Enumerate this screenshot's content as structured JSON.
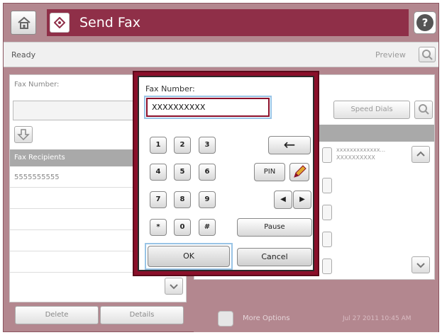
{
  "header": {
    "title": "Send Fax",
    "home_icon": "home-icon",
    "fax_icon": "fax-icon",
    "help_icon": "help-icon",
    "help_glyph": "?"
  },
  "status": {
    "text": "Ready",
    "preview_label": "Preview",
    "preview_icon": "magnifier-icon"
  },
  "left_panel": {
    "fax_number_label": "Fax Number:",
    "recipients_header": "Fax Recipients",
    "recipients": [
      "5555555555"
    ],
    "delete_label": "Delete",
    "details_label": "Details"
  },
  "right_panel": {
    "speed_dials_label": "Speed Dials",
    "entry_line1": "xxxxxxxxxxxxx...",
    "entry_line2": "XXXXXXXXXX",
    "more_options_label": "More Options",
    "datetime": "Jul 27 2011 10:45 AM"
  },
  "dialog": {
    "label": "Fax Number:",
    "input_value": "XXXXXXXXXX",
    "keys": [
      "1",
      "2",
      "3",
      "4",
      "5",
      "6",
      "7",
      "8",
      "9",
      "*",
      "0",
      "#"
    ],
    "backspace_glyph": "←",
    "pin_label": "PIN",
    "left_glyph": "◀",
    "right_glyph": "▶",
    "pause_label": "Pause",
    "ok_label": "OK",
    "cancel_label": "Cancel"
  },
  "colors": {
    "title_bar": "#8f2f48",
    "frame": "#b3878f",
    "dialog_border": "#8b0f2a",
    "focus": "#99c4e6"
  }
}
